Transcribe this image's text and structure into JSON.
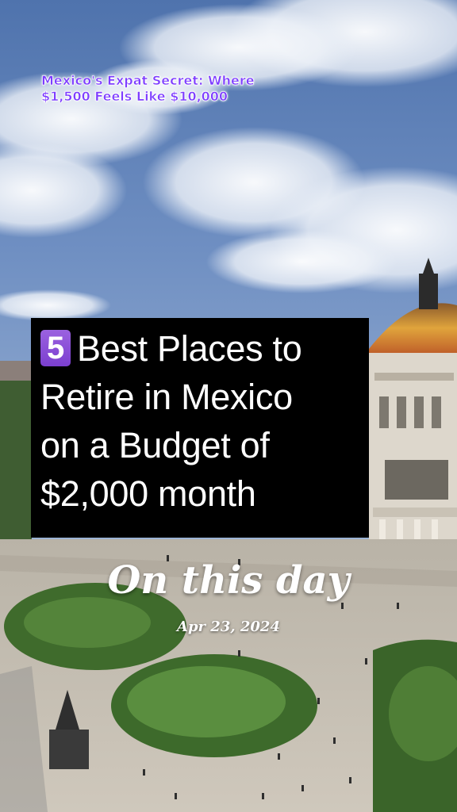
{
  "caption": {
    "text": "Mexico's Expat Secret: Where\n$1,500 Feels Like $10,000",
    "color": "#7d3cff"
  },
  "title_card": {
    "number_badge": "5",
    "text": "Best Places to\nRetire in Mexico\non a Budget of\n$2,000 month",
    "badge_color": "#8a4fd8"
  },
  "memory": {
    "heading": "On this day",
    "date": "Apr 23, 2024"
  }
}
